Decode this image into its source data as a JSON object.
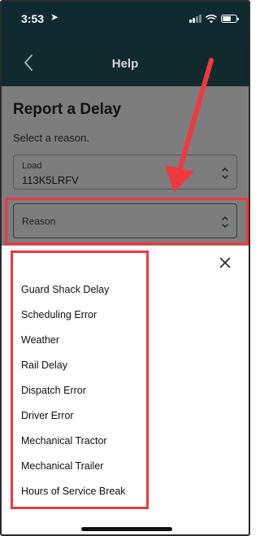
{
  "status_bar": {
    "time": "3:53",
    "location_glyph": "➤",
    "battery_level": 0.6
  },
  "header": {
    "title": "Help",
    "back_icon": "chevron-left-icon"
  },
  "page": {
    "title": "Report a Delay",
    "subtitle": "Select a reason."
  },
  "load_field": {
    "label": "Load",
    "value": "113K5LRFV"
  },
  "reason_field": {
    "label": "Reason"
  },
  "sheet": {
    "close_icon": "close-icon",
    "options": [
      "Guard Shack Delay",
      "Scheduling Error",
      "Weather",
      "Rail Delay",
      "Dispatch Error",
      "Driver Error",
      "Mechanical Tractor",
      "Mechanical Trailer",
      "Hours of Service Break"
    ]
  },
  "colors": {
    "header_bg": "#0f2a2e",
    "annotation_red": "#f0383f",
    "dim_overlay": "#7d7d7d"
  }
}
